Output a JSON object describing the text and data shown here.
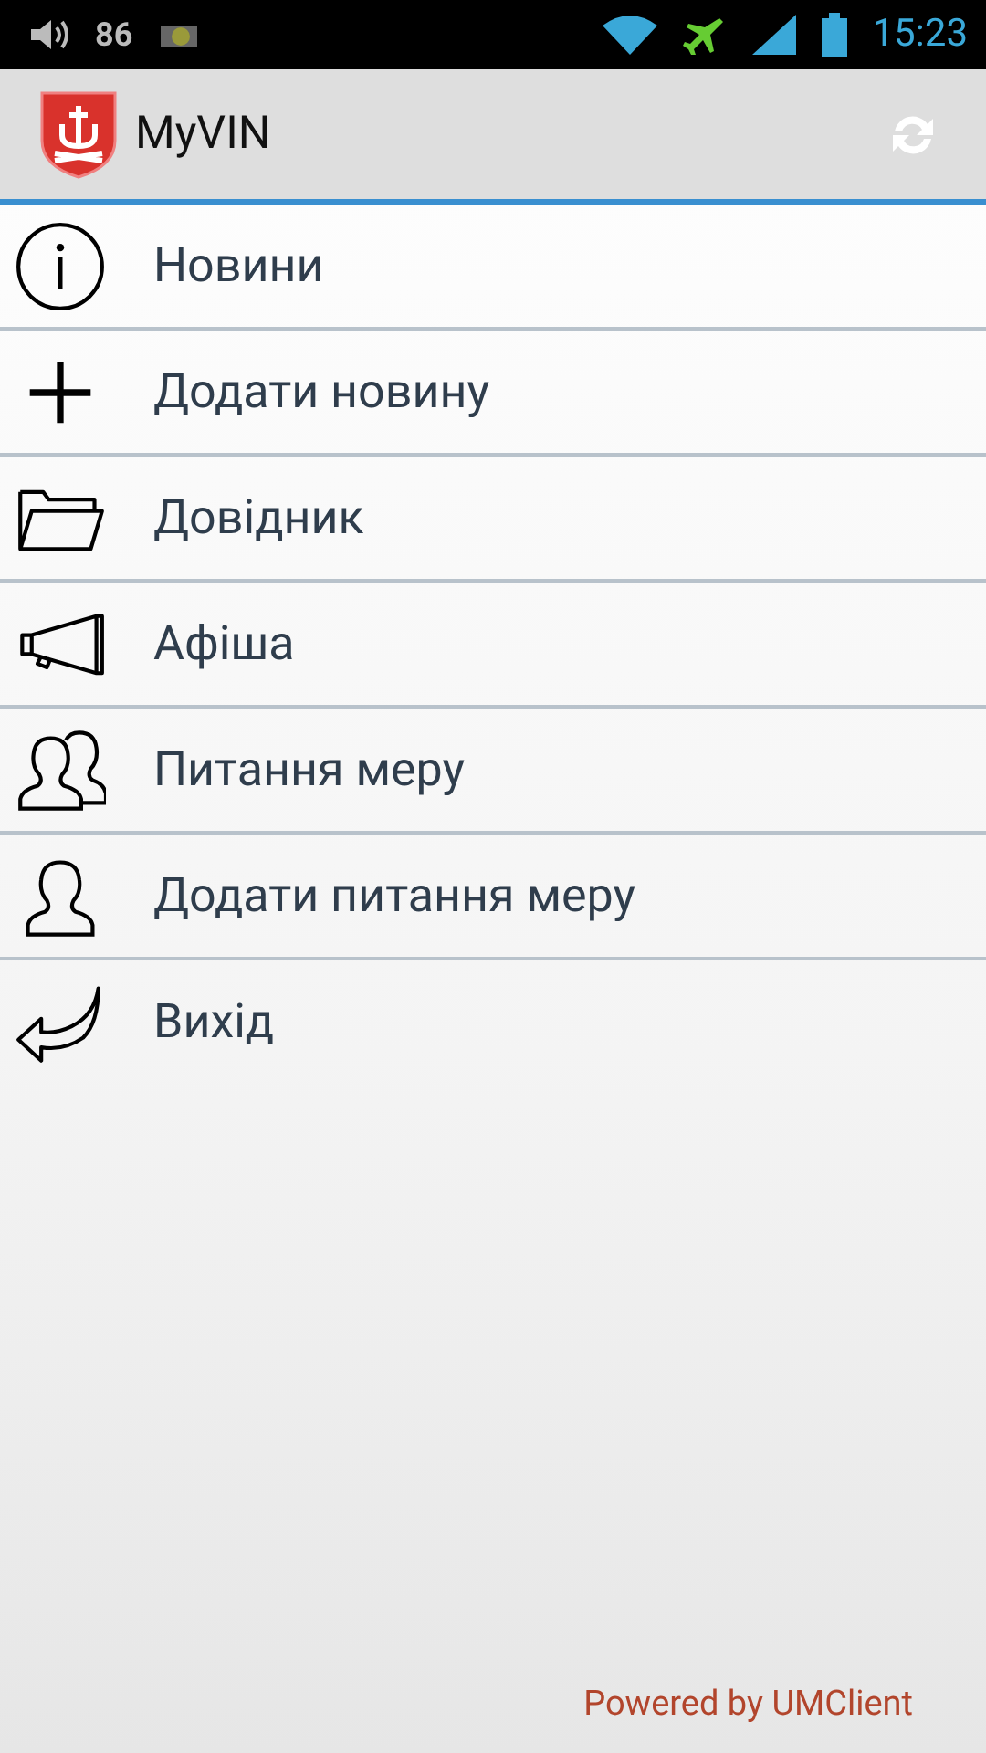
{
  "status_bar": {
    "volume": "86",
    "time": "15:23"
  },
  "app_bar": {
    "title": "MyVIN"
  },
  "menu": [
    {
      "kind": "info",
      "label": "Новини"
    },
    {
      "kind": "add",
      "label": "Додати новину"
    },
    {
      "kind": "folder",
      "label": "Довідник"
    },
    {
      "kind": "megaphone",
      "label": "Афіша"
    },
    {
      "kind": "people",
      "label": "Питання меру"
    },
    {
      "kind": "person",
      "label": "Додати питання меру"
    },
    {
      "kind": "exit",
      "label": "Вихід"
    }
  ],
  "footer": "Powered by UMClient"
}
